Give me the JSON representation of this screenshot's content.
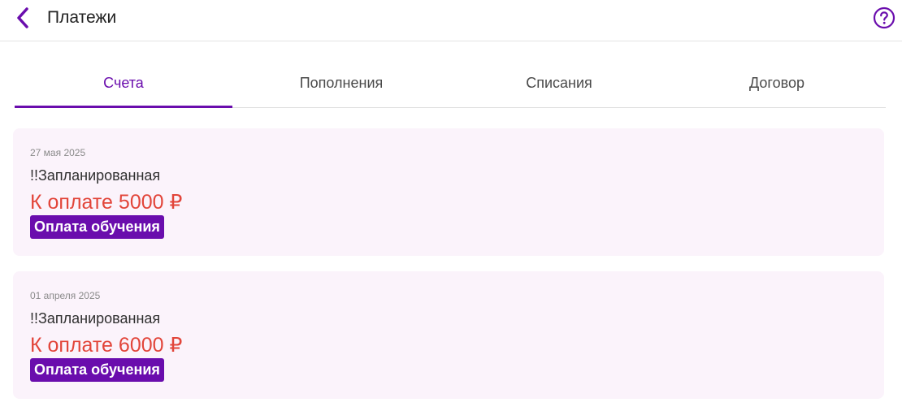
{
  "header": {
    "title": "Платежи",
    "back_icon": "chevron-left-icon",
    "help_icon": "question-circle-icon",
    "accent": "#6a0dad"
  },
  "tabs": [
    {
      "label": "Счета",
      "active": true
    },
    {
      "label": "Пополнения",
      "active": false
    },
    {
      "label": "Списания",
      "active": false
    },
    {
      "label": "Договор",
      "active": false
    }
  ],
  "invoices": [
    {
      "date": "27 мая 2025",
      "name": "!!Запланированная",
      "amount": "К оплате 5000 ₽",
      "badge": "Оплата обучения"
    },
    {
      "date": "01 апреля 2025",
      "name": "!!Запланированная",
      "amount": "К оплате 6000 ₽",
      "badge": "Оплата обучения"
    }
  ],
  "colors": {
    "amount": "#e2453a",
    "card_bg": "#fbf3fb",
    "badge_bg": "#6a0dad"
  }
}
